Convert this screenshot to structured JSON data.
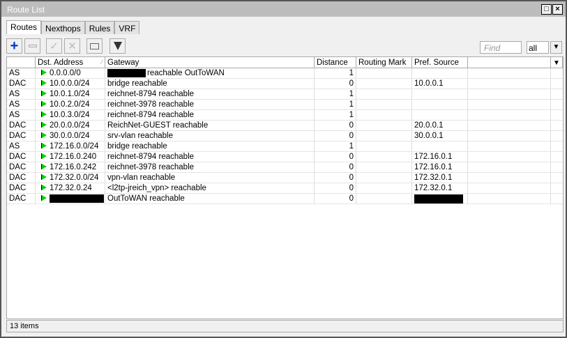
{
  "window": {
    "title": "Route List",
    "maximize_icon": "□",
    "close_icon": "×"
  },
  "tabs": [
    {
      "label": "Routes"
    },
    {
      "label": "Nexthops"
    },
    {
      "label": "Rules"
    },
    {
      "label": "VRF"
    }
  ],
  "toolbar": {
    "find_placeholder": "Find",
    "filter_value": "all"
  },
  "columns": [
    "",
    "Dst. Address",
    "Gateway",
    "Distance",
    "Routing Mark",
    "Pref. Source"
  ],
  "rows": [
    {
      "flags": "AS",
      "dst": "0.0.0.0/0",
      "dst_redacted": false,
      "gw_redacted": true,
      "gateway": "reachable OutToWAN",
      "distance": "1",
      "mark": "",
      "pref": "",
      "pref_redacted": false
    },
    {
      "flags": "DAC",
      "dst": "10.0.0.0/24",
      "gateway": "bridge reachable",
      "distance": "0",
      "mark": "",
      "pref": "10.0.0.1"
    },
    {
      "flags": "AS",
      "dst": "10.0.1.0/24",
      "gateway": "reichnet-8794 reachable",
      "distance": "1",
      "mark": "",
      "pref": ""
    },
    {
      "flags": "AS",
      "dst": "10.0.2.0/24",
      "gateway": "reichnet-3978 reachable",
      "distance": "1",
      "mark": "",
      "pref": ""
    },
    {
      "flags": "AS",
      "dst": "10.0.3.0/24",
      "gateway": "reichnet-8794 reachable",
      "distance": "1",
      "mark": "",
      "pref": ""
    },
    {
      "flags": "DAC",
      "dst": "20.0.0.0/24",
      "gateway": "ReichNet-GUEST reachable",
      "distance": "0",
      "mark": "",
      "pref": "20.0.0.1"
    },
    {
      "flags": "DAC",
      "dst": "30.0.0.0/24",
      "gateway": "srv-vlan reachable",
      "distance": "0",
      "mark": "",
      "pref": "30.0.0.1"
    },
    {
      "flags": "AS",
      "dst": "172.16.0.0/24",
      "gateway": "bridge reachable",
      "distance": "1",
      "mark": "",
      "pref": ""
    },
    {
      "flags": "DAC",
      "dst": "172.16.0.240",
      "gateway": "reichnet-8794 reachable",
      "distance": "0",
      "mark": "",
      "pref": "172.16.0.1"
    },
    {
      "flags": "DAC",
      "dst": "172.16.0.242",
      "gateway": "reichnet-3978 reachable",
      "distance": "0",
      "mark": "",
      "pref": "172.16.0.1"
    },
    {
      "flags": "DAC",
      "dst": "172.32.0.0/24",
      "gateway": "vpn-vlan reachable",
      "distance": "0",
      "mark": "",
      "pref": "172.32.0.1"
    },
    {
      "flags": "DAC",
      "dst": "172.32.0.24",
      "gateway": "<l2tp-jreich_vpn> reachable",
      "distance": "0",
      "mark": "",
      "pref": "172.32.0.1"
    },
    {
      "flags": "DAC",
      "dst": "",
      "dst_redacted": true,
      "gateway": "OutToWAN reachable",
      "distance": "0",
      "mark": "",
      "pref": "",
      "pref_redacted": true
    }
  ],
  "status": {
    "count": "13 items"
  }
}
